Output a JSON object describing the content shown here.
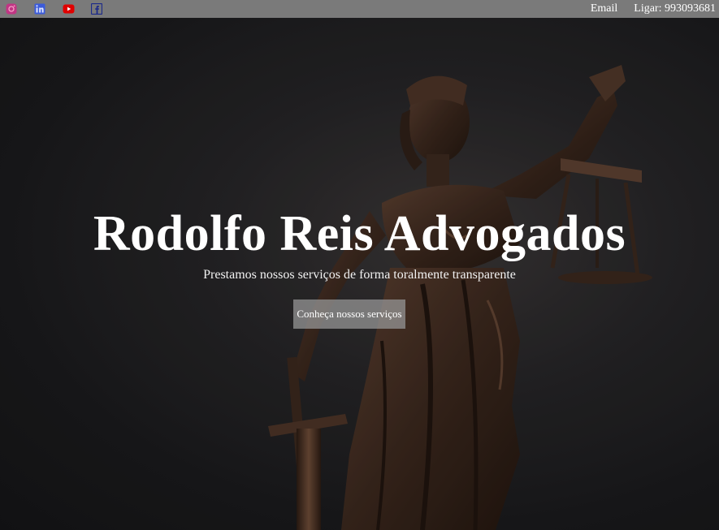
{
  "topbar": {
    "social": [
      {
        "icon": "instagram-icon",
        "color": "#c13584"
      },
      {
        "icon": "linkedin-icon",
        "color": "#3b5bdb"
      },
      {
        "icon": "youtube-icon",
        "color": "#e00000"
      },
      {
        "icon": "facebook-icon",
        "color": "#1c2a8a"
      }
    ],
    "email_label": "Email",
    "phone_label": "Ligar: 993093681"
  },
  "hero": {
    "title": "Rodolfo Reis Advogados",
    "subtitle": "Prestamos nossos serviços de forma toralmente transparente",
    "button_label": "Conheça nossos serviços"
  },
  "colors": {
    "topbar_bg": "#7a7a7a",
    "background": "#1c1c1e",
    "text": "#ffffff"
  }
}
